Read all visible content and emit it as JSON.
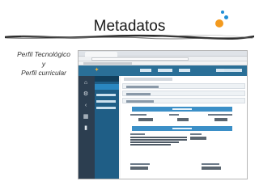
{
  "slide": {
    "title": "Metadatos",
    "side_lines": [
      "Perfil Tecnológico",
      "y",
      "Perfil curricular"
    ]
  },
  "colors": {
    "app_header": "#2a6f97",
    "sidebar": "#2c3e50",
    "menu": "#1f5e86",
    "section_bar": "#3b8fc7",
    "dot_blue": "#1f8fd6",
    "dot_orange": "#f39a1e"
  },
  "screenshot": {
    "icons": [
      "home-icon",
      "gear-icon",
      "chevron-left-icon",
      "chart-icon",
      "bookmark-icon"
    ]
  }
}
